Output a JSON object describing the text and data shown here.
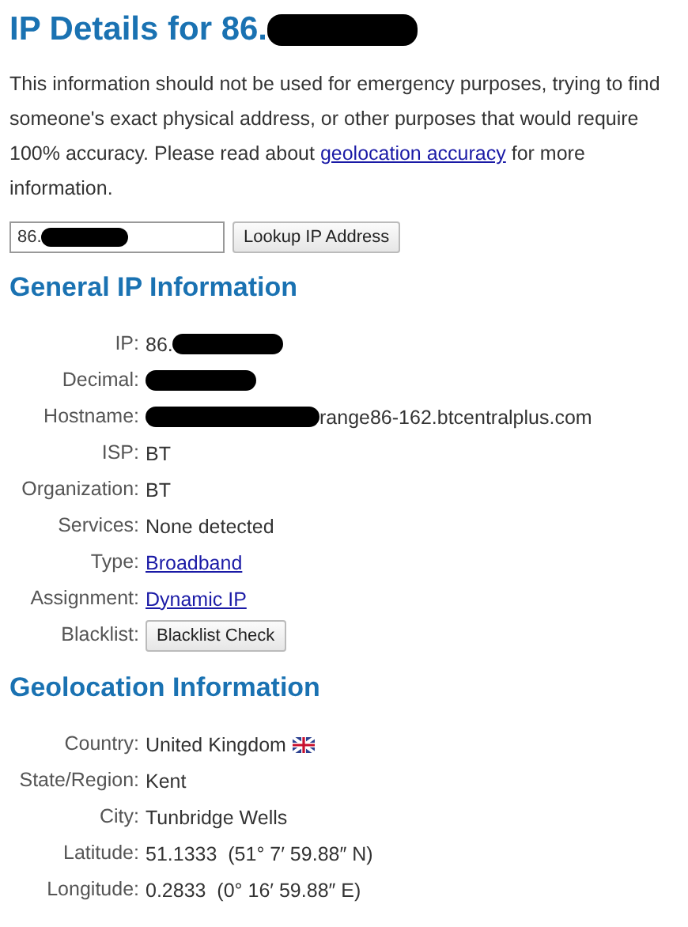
{
  "title": {
    "parts": [
      {
        "kind": "text",
        "text": "IP Details for 86."
      },
      {
        "kind": "redaction"
      }
    ]
  },
  "notice": {
    "before": "This information should not be used for emergency purposes, trying to find someone's exact physical address, or other purposes that would require 100% accuracy. Please read about",
    "link": "geolocation accuracy",
    "after": "for more information."
  },
  "lookup": {
    "value": "86.",
    "redacted": true,
    "button": "Lookup IP Address"
  },
  "sections": [
    {
      "heading": "General IP Information",
      "rows": [
        {
          "label": "IP:",
          "parts": [
            {
              "kind": "text",
              "text": "86."
            },
            {
              "kind": "redaction"
            }
          ]
        },
        {
          "label": "Decimal:",
          "parts": [
            {
              "kind": "redaction"
            }
          ]
        },
        {
          "label": "Hostname:",
          "parts": [
            {
              "kind": "redaction",
              "wide": true
            },
            {
              "kind": "text",
              "text": "range86-162.btcentralplus.com"
            }
          ]
        },
        {
          "label": "ISP:",
          "parts": [
            {
              "kind": "text",
              "text": "BT"
            }
          ]
        },
        {
          "label": "Organization:",
          "parts": [
            {
              "kind": "text",
              "text": "BT"
            }
          ]
        },
        {
          "label": "Services:",
          "parts": [
            {
              "kind": "text",
              "text": "None detected"
            }
          ]
        },
        {
          "label": "Type:",
          "parts": [
            {
              "kind": "link",
              "text": "Broadband"
            }
          ]
        },
        {
          "label": "Assignment:",
          "parts": [
            {
              "kind": "link",
              "text": "Dynamic IP"
            }
          ]
        },
        {
          "label": "Blacklist:",
          "parts": [
            {
              "kind": "button",
              "text": "Blacklist Check"
            }
          ]
        }
      ]
    },
    {
      "heading": "Geolocation Information",
      "rows": [
        {
          "label": "Country:",
          "parts": [
            {
              "kind": "text",
              "text": "United Kingdom"
            },
            {
              "kind": "flag"
            }
          ]
        },
        {
          "label": "State/Region:",
          "parts": [
            {
              "kind": "text",
              "text": "Kent"
            }
          ]
        },
        {
          "label": "City:",
          "parts": [
            {
              "kind": "text",
              "text": "Tunbridge Wells"
            }
          ]
        },
        {
          "label": "Latitude:",
          "parts": [
            {
              "kind": "text",
              "text": "51.1333  (51° 7′ 59.88″ N)"
            }
          ]
        },
        {
          "label": "Longitude:",
          "parts": [
            {
              "kind": "text",
              "text": "0.2833  (0° 16′ 59.88″ E)"
            }
          ]
        }
      ]
    }
  ]
}
